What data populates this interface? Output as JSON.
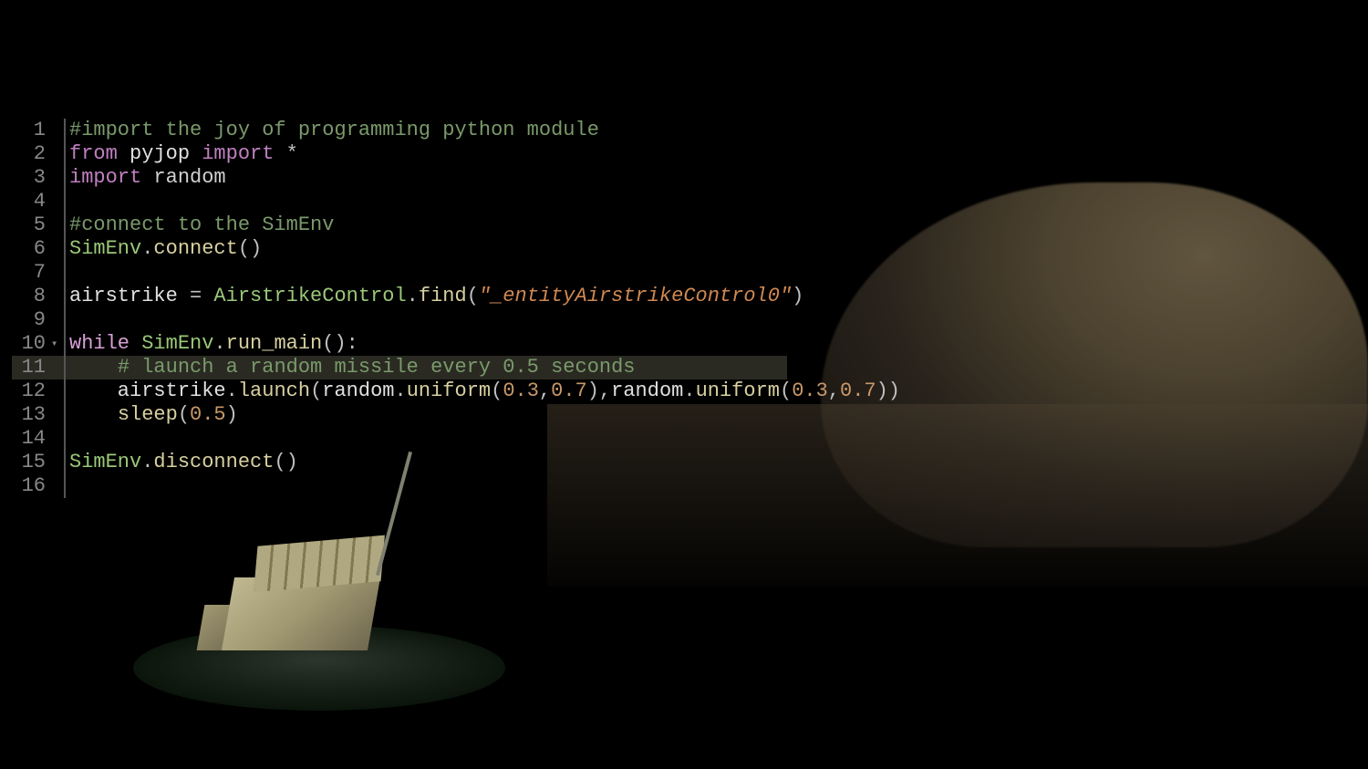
{
  "editor": {
    "highlighted_line": 11,
    "fold_marker_line": 10,
    "lines": [
      {
        "n": 1,
        "tokens": [
          {
            "t": "#import the joy of programming python module",
            "c": "comment"
          }
        ]
      },
      {
        "n": 2,
        "tokens": [
          {
            "t": "from",
            "c": "keyword"
          },
          {
            "t": " pyjop ",
            "c": "ident"
          },
          {
            "t": "import",
            "c": "keyword"
          },
          {
            "t": " *",
            "c": "punct"
          }
        ]
      },
      {
        "n": 3,
        "tokens": [
          {
            "t": "import",
            "c": "keyword"
          },
          {
            "t": " random",
            "c": "builtin"
          }
        ]
      },
      {
        "n": 4,
        "tokens": []
      },
      {
        "n": 5,
        "tokens": [
          {
            "t": "#connect to the SimEnv",
            "c": "comment"
          }
        ]
      },
      {
        "n": 6,
        "tokens": [
          {
            "t": "SimEnv",
            "c": "classname"
          },
          {
            "t": ".",
            "c": "punct"
          },
          {
            "t": "connect",
            "c": "method"
          },
          {
            "t": "()",
            "c": "punct"
          }
        ]
      },
      {
        "n": 7,
        "tokens": []
      },
      {
        "n": 8,
        "tokens": [
          {
            "t": "airstrike ",
            "c": "ident"
          },
          {
            "t": "=",
            "c": "punct"
          },
          {
            "t": " AirstrikeControl",
            "c": "classname"
          },
          {
            "t": ".",
            "c": "punct"
          },
          {
            "t": "find",
            "c": "method"
          },
          {
            "t": "(",
            "c": "punct"
          },
          {
            "t": "\"_entityAirstrikeControl0\"",
            "c": "string"
          },
          {
            "t": ")",
            "c": "punct"
          }
        ]
      },
      {
        "n": 9,
        "tokens": []
      },
      {
        "n": 10,
        "tokens": [
          {
            "t": "while",
            "c": "keyword2"
          },
          {
            "t": " SimEnv",
            "c": "classname"
          },
          {
            "t": ".",
            "c": "punct"
          },
          {
            "t": "run_main",
            "c": "method"
          },
          {
            "t": "():",
            "c": "punct"
          }
        ]
      },
      {
        "n": 11,
        "tokens": [
          {
            "t": "    ",
            "c": "ident"
          },
          {
            "t": "# launch a random missile every 0.5 seconds",
            "c": "comment"
          }
        ]
      },
      {
        "n": 12,
        "tokens": [
          {
            "t": "    airstrike",
            "c": "ident"
          },
          {
            "t": ".",
            "c": "punct"
          },
          {
            "t": "launch",
            "c": "method"
          },
          {
            "t": "(",
            "c": "punct"
          },
          {
            "t": "random",
            "c": "ident"
          },
          {
            "t": ".",
            "c": "punct"
          },
          {
            "t": "uniform",
            "c": "method"
          },
          {
            "t": "(",
            "c": "punct"
          },
          {
            "t": "0.3",
            "c": "number"
          },
          {
            "t": ",",
            "c": "punct"
          },
          {
            "t": "0.7",
            "c": "number"
          },
          {
            "t": "),",
            "c": "punct"
          },
          {
            "t": "random",
            "c": "ident"
          },
          {
            "t": ".",
            "c": "punct"
          },
          {
            "t": "uniform",
            "c": "method"
          },
          {
            "t": "(",
            "c": "punct"
          },
          {
            "t": "0.3",
            "c": "number"
          },
          {
            "t": ",",
            "c": "punct"
          },
          {
            "t": "0.7",
            "c": "number"
          },
          {
            "t": "))",
            "c": "punct"
          }
        ]
      },
      {
        "n": 13,
        "tokens": [
          {
            "t": "    ",
            "c": "ident"
          },
          {
            "t": "sleep",
            "c": "method"
          },
          {
            "t": "(",
            "c": "punct"
          },
          {
            "t": "0.5",
            "c": "number"
          },
          {
            "t": ")",
            "c": "punct"
          }
        ]
      },
      {
        "n": 14,
        "tokens": []
      },
      {
        "n": 15,
        "tokens": [
          {
            "t": "SimEnv",
            "c": "classname"
          },
          {
            "t": ".",
            "c": "punct"
          },
          {
            "t": "disconnect",
            "c": "method"
          },
          {
            "t": "()",
            "c": "punct"
          }
        ]
      },
      {
        "n": 16,
        "tokens": []
      }
    ]
  }
}
